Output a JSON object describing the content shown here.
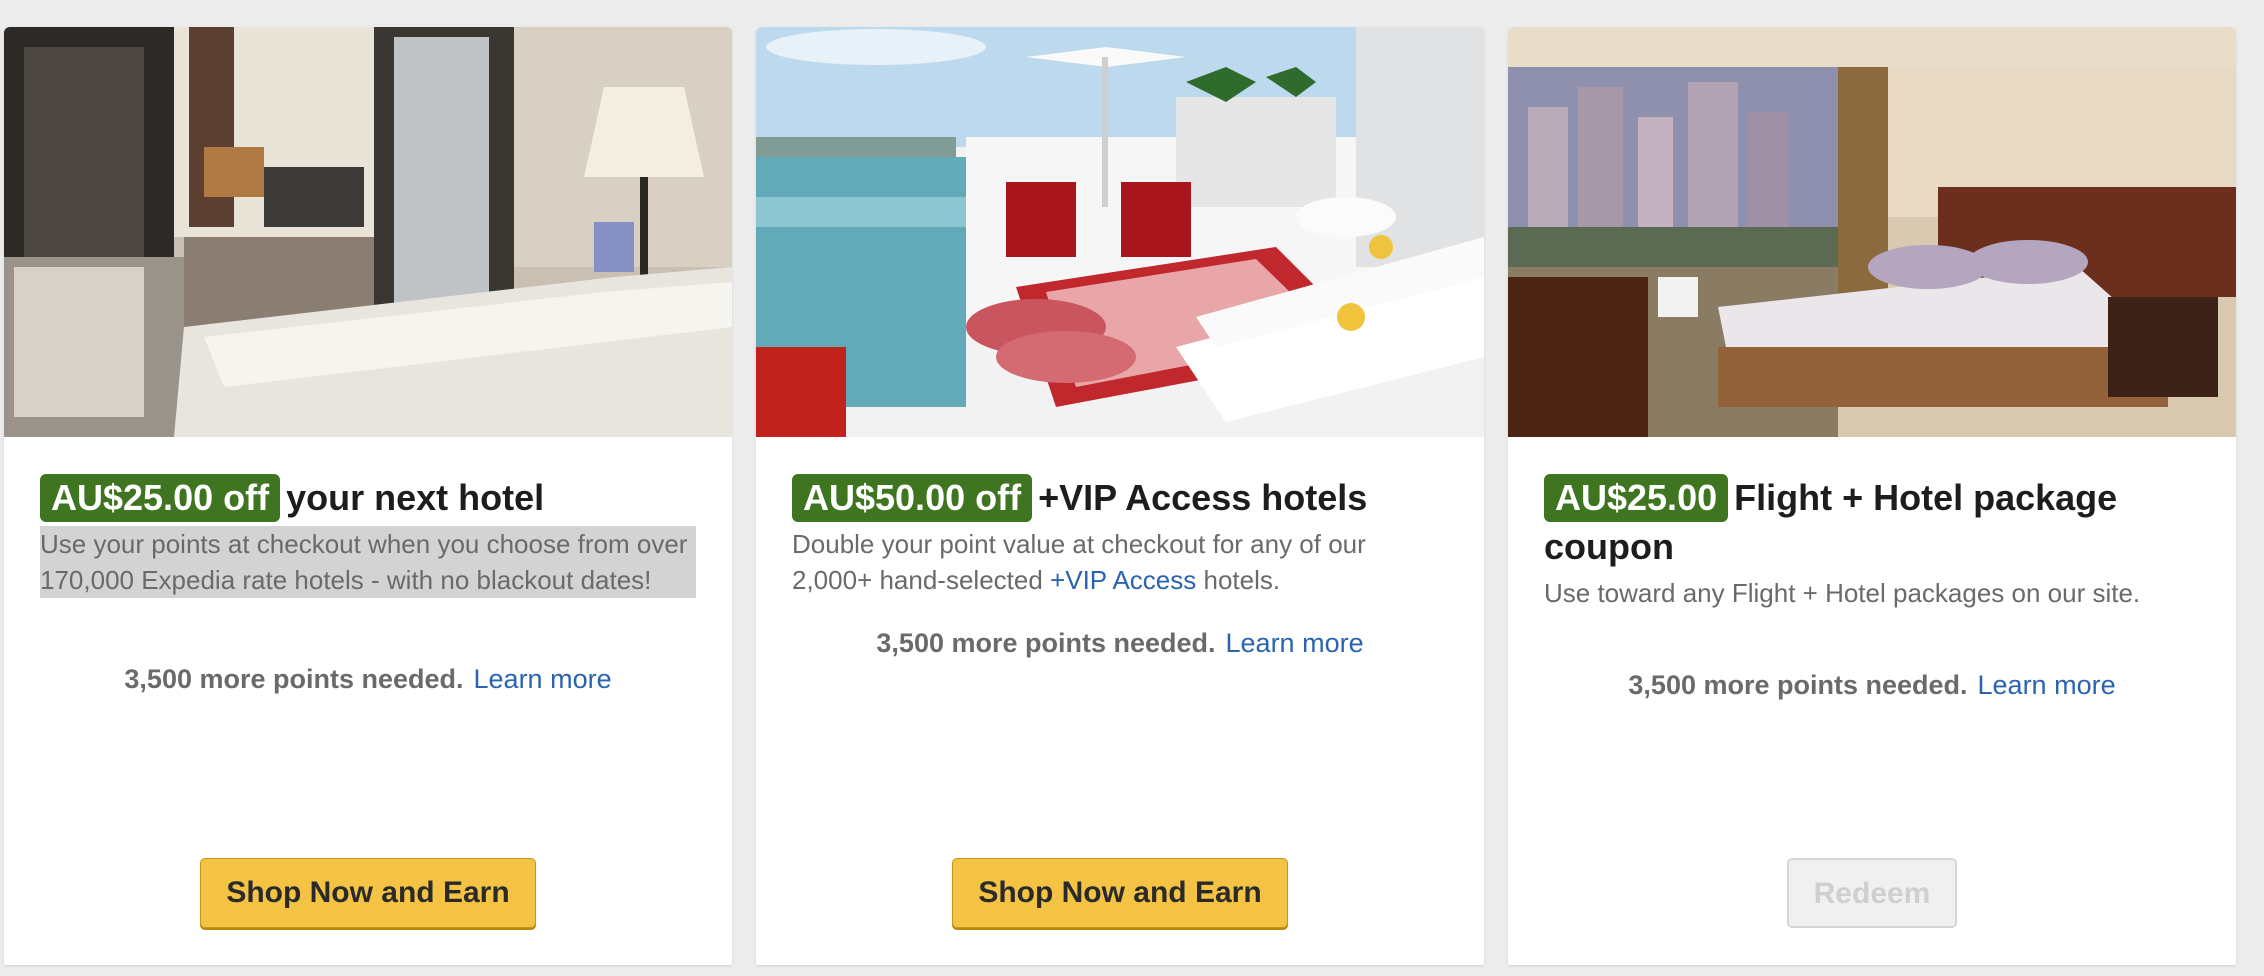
{
  "cards": [
    {
      "badge": "AU$25.00 off",
      "title": "your next hotel",
      "description": "Use your points at checkout when you choose from over 170,000 Expedia rate hotels - with no blackout dates!",
      "points_needed": "3,500 more points needed.",
      "learn_more": "Learn more",
      "button": "Shop Now and Earn",
      "image": "hotel-suite-photo"
    },
    {
      "badge": "AU$50.00 off",
      "title": "+VIP Access hotels",
      "description_before": "Double your point value at checkout for any of our 2,000+ hand-selected ",
      "description_link": "+VIP Access",
      "description_after": " hotels.",
      "points_needed": "3,500 more points needed.",
      "learn_more": "Learn more",
      "button": "Shop Now and Earn",
      "image": "rooftop-terrace-photo"
    },
    {
      "badge": "AU$25.00",
      "title": "Flight + Hotel package coupon",
      "description": "Use toward any Flight + Hotel packages on our site.",
      "points_needed": "3,500 more points needed.",
      "learn_more": "Learn more",
      "button": "Redeem",
      "button_disabled": true,
      "image": "city-view-bedroom-photo"
    }
  ],
  "colors": {
    "badge_green": "#3f7520",
    "link_blue": "#2a64b0",
    "button_yellow": "#f5c344",
    "page_background": "#ececec"
  }
}
